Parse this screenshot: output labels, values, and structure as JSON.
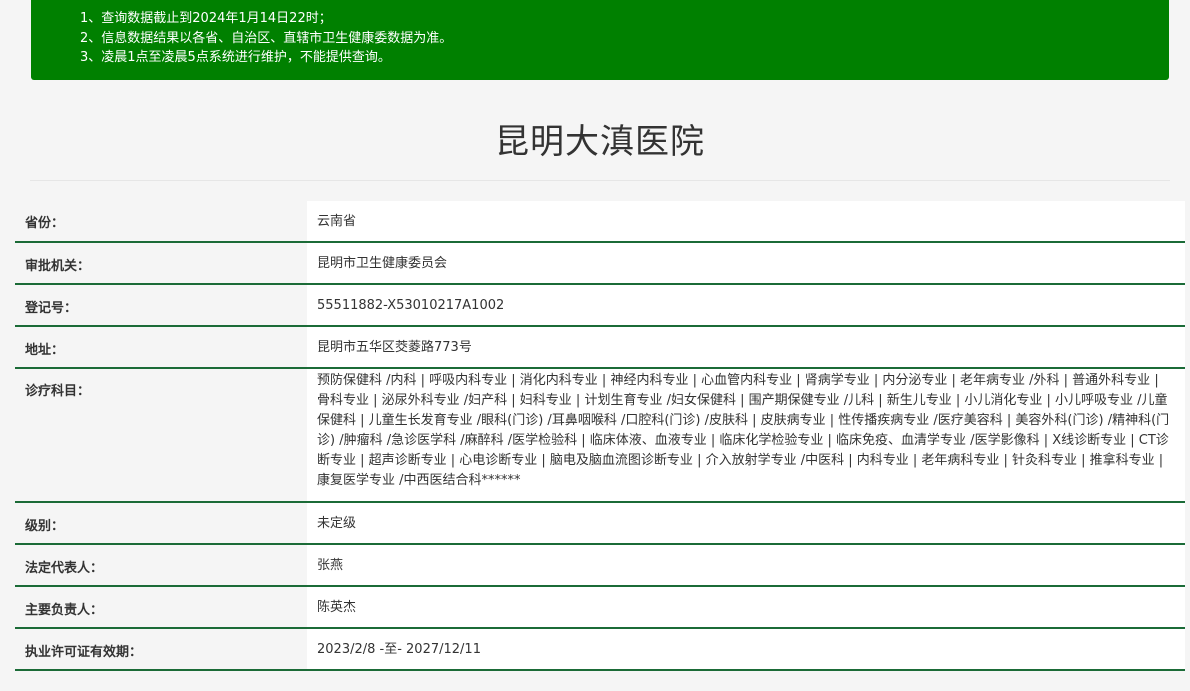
{
  "notice": {
    "lines": [
      "1、查询数据截止到2024年1月14日22时；",
      "2、信息数据结果以各省、自治区、直辖市卫生健康委数据为准。",
      "3、凌晨1点至凌晨5点系统进行维护，不能提供查询。"
    ],
    "background_color": "#008000"
  },
  "hospital": {
    "title": "昆明大滇医院"
  },
  "fields": [
    {
      "label": "省份：",
      "value": "云南省"
    },
    {
      "label": "审批机关：",
      "value": "昆明市卫生健康委员会"
    },
    {
      "label": "登记号：",
      "value": "55511882-X53010217A1002"
    },
    {
      "label": "地址：",
      "value": "昆明市五华区茭菱路773号"
    },
    {
      "label": "诊疗科目：",
      "value": "预防保健科 /内科 | 呼吸内科专业 | 消化内科专业 | 神经内科专业 | 心血管内科专业 | 肾病学专业 | 内分泌专业 | 老年病专业 /外科 | 普通外科专业 | 骨科专业 | 泌尿外科专业 /妇产科 | 妇科专业 | 计划生育专业 /妇女保健科 | 围产期保健专业 /儿科 | 新生儿专业 | 小儿消化专业 | 小儿呼吸专业 /儿童保健科 | 儿童生长发育专业 /眼科(门诊) /耳鼻咽喉科 /口腔科(门诊) /皮肤科 | 皮肤病专业 | 性传播疾病专业 /医疗美容科 | 美容外科(门诊) /精神科(门诊) /肿瘤科 /急诊医学科 /麻醉科 /医学检验科 | 临床体液、血液专业 | 临床化学检验专业 | 临床免疫、血清学专业 /医学影像科 | X线诊断专业 | CT诊断专业 | 超声诊断专业 | 心电诊断专业 | 脑电及脑血流图诊断专业 | 介入放射学专业 /中医科 | 内科专业 | 老年病科专业 | 针灸科专业 | 推拿科专业 | 康复医学专业 /中西医结合科******"
    },
    {
      "label": "级别：",
      "value": "未定级"
    },
    {
      "label": "法定代表人：",
      "value": "张燕"
    },
    {
      "label": "主要负责人：",
      "value": "陈英杰"
    },
    {
      "label": "执业许可证有效期：",
      "value": "2023/2/8 -至- 2027/12/11"
    }
  ],
  "colors": {
    "row_divider": "#1b6b37",
    "label_bg": "#f5f5f5",
    "value_bg": "#ffffff"
  }
}
